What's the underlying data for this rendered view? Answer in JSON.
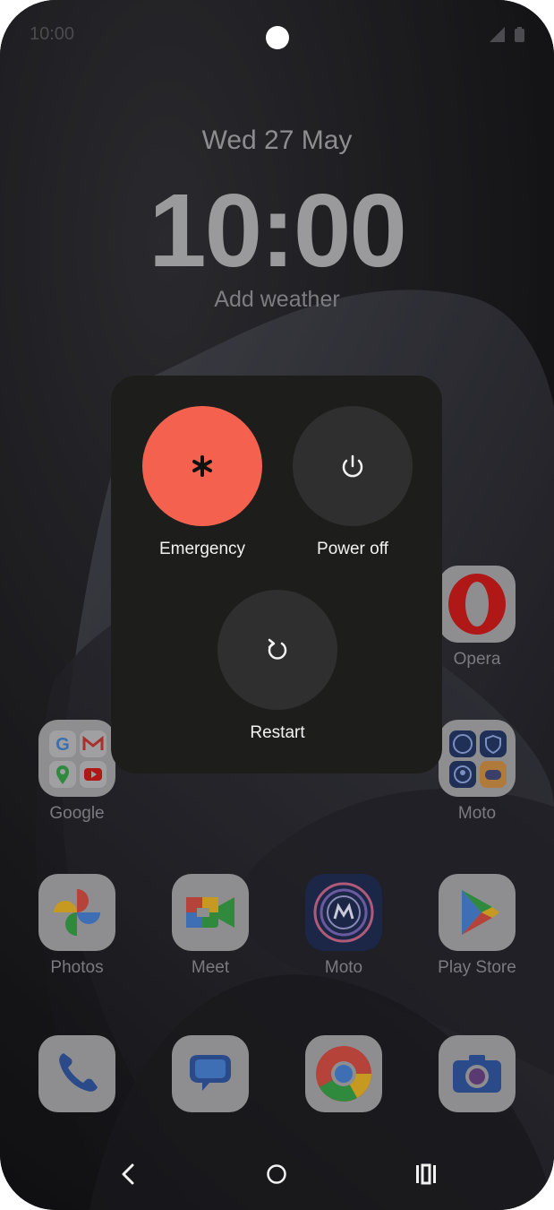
{
  "status_bar": {
    "time": "10:00"
  },
  "lock": {
    "date": "Wed 27 May",
    "time": "10:00",
    "weather": "Add weather"
  },
  "apps": {
    "opera": "Opera",
    "google": "Google",
    "moto_folder": "Moto",
    "photos": "Photos",
    "meet": "Meet",
    "moto": "Moto",
    "play_store": "Play Store"
  },
  "power_menu": {
    "emergency": "Emergency",
    "power_off": "Power off",
    "restart": "Restart"
  },
  "colors": {
    "emergency": "#f4624f",
    "panel": "#1d1e1c",
    "button": "#2f2f2f"
  }
}
